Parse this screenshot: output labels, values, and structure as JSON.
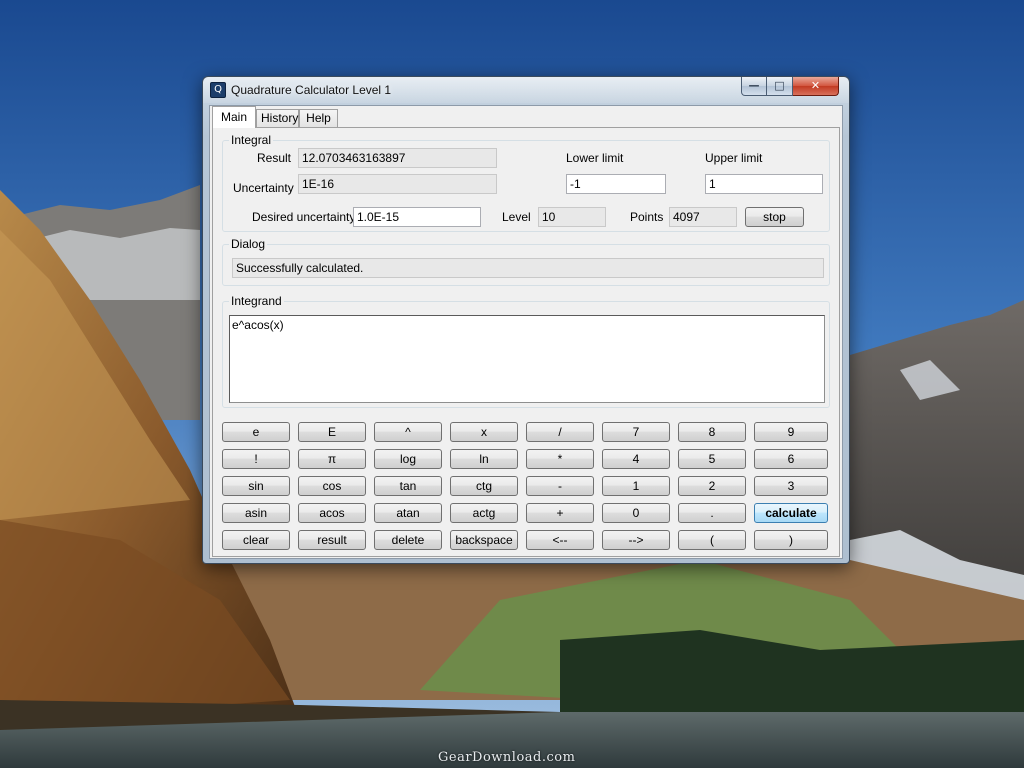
{
  "window": {
    "title": "Quadrature Calculator Level 1",
    "icon": "quadrature-app-icon",
    "icon_glyph": "Q",
    "minimize_glyph": "—",
    "maximize_glyph": "□",
    "close_glyph": "✕"
  },
  "tabs": [
    {
      "label": "Main",
      "active": true
    },
    {
      "label": "History",
      "active": false
    },
    {
      "label": "Help",
      "active": false
    }
  ],
  "integral": {
    "group_label": "Integral",
    "result_label": "Result",
    "result_value": "12.0703463163897",
    "uncertainty_label": "Uncertainty",
    "uncertainty_value": "1E-16",
    "lower_limit_label": "Lower limit",
    "lower_limit_value": "-1",
    "upper_limit_label": "Upper limit",
    "upper_limit_value": "1",
    "desired_uncertainty_label": "Desired uncertainty",
    "desired_uncertainty_value": "1.0E-15",
    "level_label": "Level",
    "level_value": "10",
    "points_label": "Points",
    "points_value": "4097",
    "stop_label": "stop"
  },
  "dialog": {
    "group_label": "Dialog",
    "message": "Successfully calculated."
  },
  "integrand": {
    "group_label": "Integrand",
    "expression": "e^acos(x)"
  },
  "keypad": {
    "rows": [
      [
        "e",
        "E",
        "^",
        "x",
        "/",
        "7",
        "8",
        "9"
      ],
      [
        "!",
        "π",
        "log",
        "ln",
        "*",
        "4",
        "5",
        "6"
      ],
      [
        "sin",
        "cos",
        "tan",
        "ctg",
        "-",
        "1",
        "2",
        "3"
      ],
      [
        "asin",
        "acos",
        "atan",
        "actg",
        "+",
        "0",
        ".",
        "calculate"
      ],
      [
        "clear",
        "result",
        "delete",
        "backspace",
        "<--",
        "-->",
        "(",
        ")"
      ]
    ],
    "default_button": "calculate"
  },
  "watermark": "GearDownload.com",
  "colors": {
    "sky_top": "#1d4f9a",
    "sky_bottom": "#8fb6dd",
    "default_button": "#bee6fd",
    "close_button": "#c23a22"
  }
}
